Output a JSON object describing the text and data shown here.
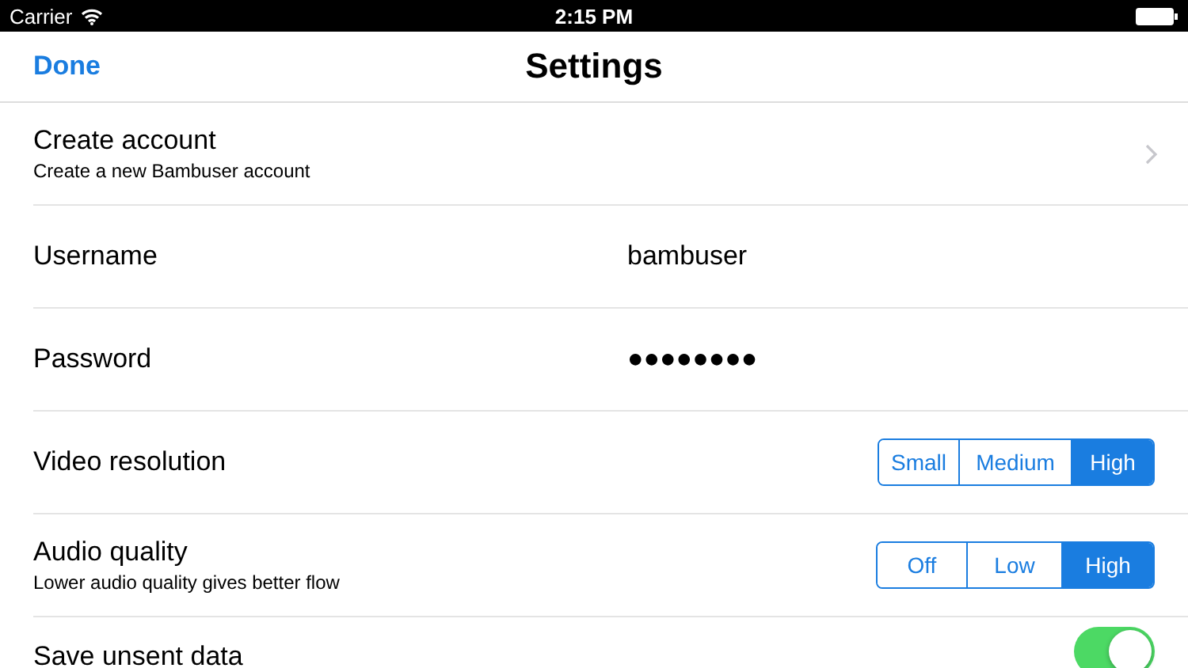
{
  "status_bar": {
    "carrier": "Carrier",
    "time": "2:15 PM"
  },
  "nav_bar": {
    "left_button": "Done",
    "title": "Settings"
  },
  "rows": [
    {
      "kind": "link",
      "title": "Create account",
      "subtitle": "Create a new Bambuser account"
    },
    {
      "kind": "text",
      "title": "Username",
      "value": "bambuser"
    },
    {
      "kind": "text",
      "title": "Password",
      "value": "●●●●●●●●"
    },
    {
      "kind": "segmented",
      "title": "Video resolution",
      "segments": [
        {
          "label": "Small",
          "selected": false
        },
        {
          "label": "Medium",
          "selected": false
        },
        {
          "label": "High",
          "selected": true
        }
      ]
    },
    {
      "kind": "segmented",
      "title": "Audio quality",
      "subtitle": "Lower audio quality gives better flow",
      "segments": [
        {
          "label": "Off",
          "selected": false
        },
        {
          "label": "Low",
          "selected": false
        },
        {
          "label": "High",
          "selected": true
        }
      ]
    },
    {
      "kind": "toggle",
      "title": "Save unsent data",
      "on": true
    }
  ]
}
